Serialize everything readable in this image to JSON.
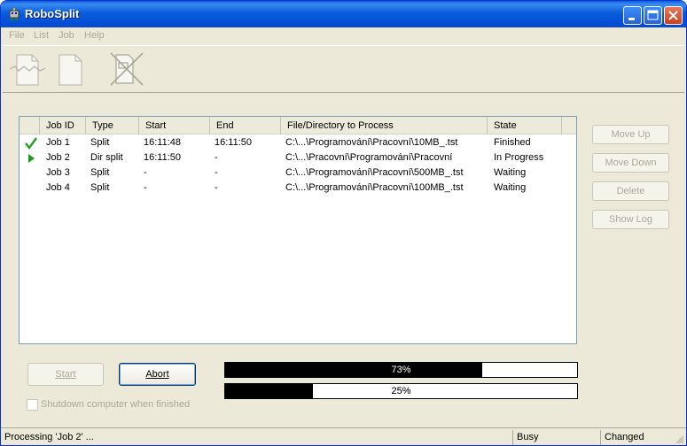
{
  "window": {
    "title": "RoboSplit"
  },
  "menu": [
    "File",
    "List",
    "Job",
    "Help"
  ],
  "toolbar": {
    "icons": [
      "split-file-icon",
      "blank-file-icon",
      "delete-file-icon"
    ]
  },
  "jobs": {
    "columns": [
      "Job ID",
      "Type",
      "Start",
      "End",
      "File/Directory to Process",
      "State"
    ],
    "rows": [
      {
        "status_icon": "checkmark-icon",
        "id": "Job 1",
        "type": "Split",
        "start": "16:11:48",
        "end": "16:11:50",
        "path": "C:\\...\\Programování\\Pracovní\\10MB_.tst",
        "state": "Finished"
      },
      {
        "status_icon": "play-arrow-icon",
        "id": "Job 2",
        "type": "Dir split",
        "start": "16:11:50",
        "end": "-",
        "path": "C:\\...\\Pracovní\\Programování\\Pracovní",
        "state": "In Progress"
      },
      {
        "status_icon": "",
        "id": "Job 3",
        "type": "Split",
        "start": "-",
        "end": "-",
        "path": "C:\\...\\Programování\\Pracovní\\500MB_.tst",
        "state": "Waiting"
      },
      {
        "status_icon": "",
        "id": "Job 4",
        "type": "Split",
        "start": "-",
        "end": "-",
        "path": "C:\\...\\Programování\\Pracovní\\100MB_.tst",
        "state": "Waiting"
      }
    ]
  },
  "side_buttons": {
    "move_up": "Move Up",
    "move_down": "Move Down",
    "delete": "Delete",
    "show_log": "Show Log"
  },
  "controls": {
    "start": "Start",
    "abort": "Abort",
    "shutdown_label": "Shutdown computer when finished",
    "shutdown_checked": false
  },
  "progress": {
    "job_percent": 73,
    "job_label": "73%",
    "overall_percent": 25,
    "overall_label": "25%"
  },
  "statusbar": {
    "message": "Processing 'Job 2' ...",
    "state": "Busy",
    "modified": "Changed"
  },
  "colors": {
    "title_bar": "#0a5ddb",
    "face": "#ece9d8",
    "check_green": "#2a9d2a",
    "arrow_green": "#1f9a1f"
  }
}
